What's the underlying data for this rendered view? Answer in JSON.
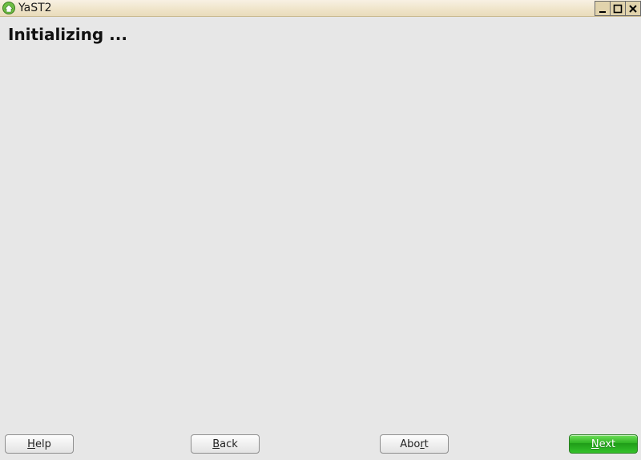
{
  "window": {
    "title": "YaST2",
    "icon": "yast-house-icon"
  },
  "heading": "Initializing ...",
  "buttons": {
    "help": {
      "pre": "",
      "mn": "H",
      "post": "elp"
    },
    "back": {
      "pre": "",
      "mn": "B",
      "post": "ack"
    },
    "abort": {
      "pre": "Abo",
      "mn": "r",
      "post": "t"
    },
    "next": {
      "pre": "",
      "mn": "N",
      "post": "ext"
    }
  },
  "colors": {
    "primary_button": "#34c22a",
    "titlebar_gradient_top": "#f8f1e3",
    "titlebar_gradient_bottom": "#e9dcbb",
    "background": "#e7e7e7"
  }
}
